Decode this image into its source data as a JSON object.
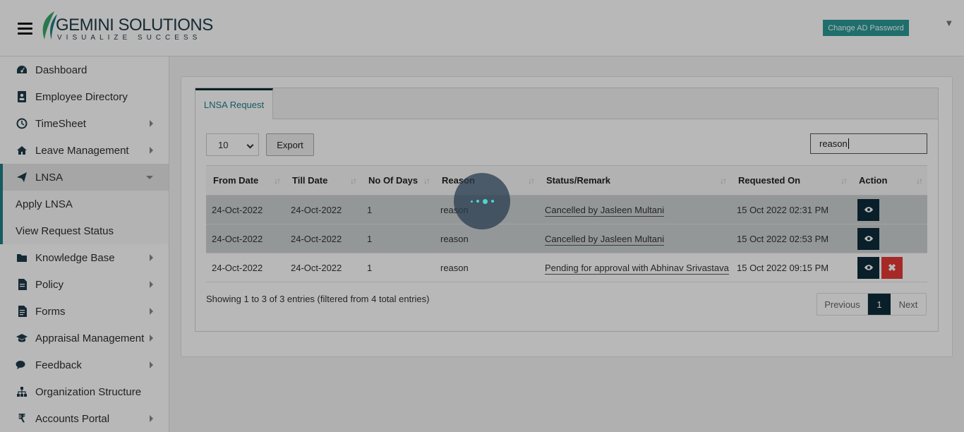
{
  "header": {
    "brand": "GEMINI SOLUTIONS",
    "tagline": "VISUALIZE SUCCESS",
    "change_password_label": "Change AD Password"
  },
  "sidebar": {
    "items": [
      {
        "label": "Dashboard",
        "icon": "dashboard-icon",
        "has_arrow": false
      },
      {
        "label": "Employee Directory",
        "icon": "address-book-icon",
        "has_arrow": false
      },
      {
        "label": "TimeSheet",
        "icon": "clock-icon",
        "has_arrow": true
      },
      {
        "label": "Leave Management",
        "icon": "home-icon",
        "has_arrow": true
      },
      {
        "label": "LNSA",
        "icon": "paper-plane-icon",
        "has_arrow": true,
        "active": true
      },
      {
        "label": "Knowledge Base",
        "icon": "folder-icon",
        "has_arrow": true
      },
      {
        "label": "Policy",
        "icon": "document-icon",
        "has_arrow": true
      },
      {
        "label": "Forms",
        "icon": "form-icon",
        "has_arrow": true
      },
      {
        "label": "Appraisal Management",
        "icon": "graduation-cap-icon",
        "has_arrow": true
      },
      {
        "label": "Feedback",
        "icon": "comments-icon",
        "has_arrow": true
      },
      {
        "label": "Organization Structure",
        "icon": "org-chart-icon",
        "has_arrow": false
      },
      {
        "label": "Accounts Portal",
        "icon": "rupee-icon",
        "has_arrow": true
      }
    ],
    "lnsa_sub": [
      "Apply LNSA",
      "View Request Status"
    ]
  },
  "tabs": [
    "LNSA Request"
  ],
  "controls": {
    "page_length": "10",
    "export_label": "Export",
    "search_value": "reason"
  },
  "table": {
    "columns": [
      "From Date",
      "Till Date",
      "No Of Days",
      "Reason",
      "Status/Remark",
      "Requested On",
      "Action"
    ],
    "rows": [
      [
        "24-Oct-2022",
        "24-Oct-2022",
        "1",
        "reason",
        "Cancelled by Jasleen Multani",
        "15 Oct 2022 02:31 PM"
      ],
      [
        "24-Oct-2022",
        "24-Oct-2022",
        "1",
        "reason",
        "Cancelled by Jasleen Multani",
        "15 Oct 2022 02:53 PM"
      ],
      [
        "24-Oct-2022",
        "24-Oct-2022",
        "1",
        "reason",
        "Pending for approval with Abhinav Srivastava",
        "15 Oct 2022 09:15 PM"
      ]
    ]
  },
  "footer": {
    "info": "Showing 1 to 3 of 3 entries (filtered from 4 total entries)",
    "prev": "Previous",
    "page": "1",
    "next": "Next"
  },
  "colors": {
    "accent": "#1f7f85",
    "dark": "#0d2c3a",
    "danger": "#e53935"
  }
}
